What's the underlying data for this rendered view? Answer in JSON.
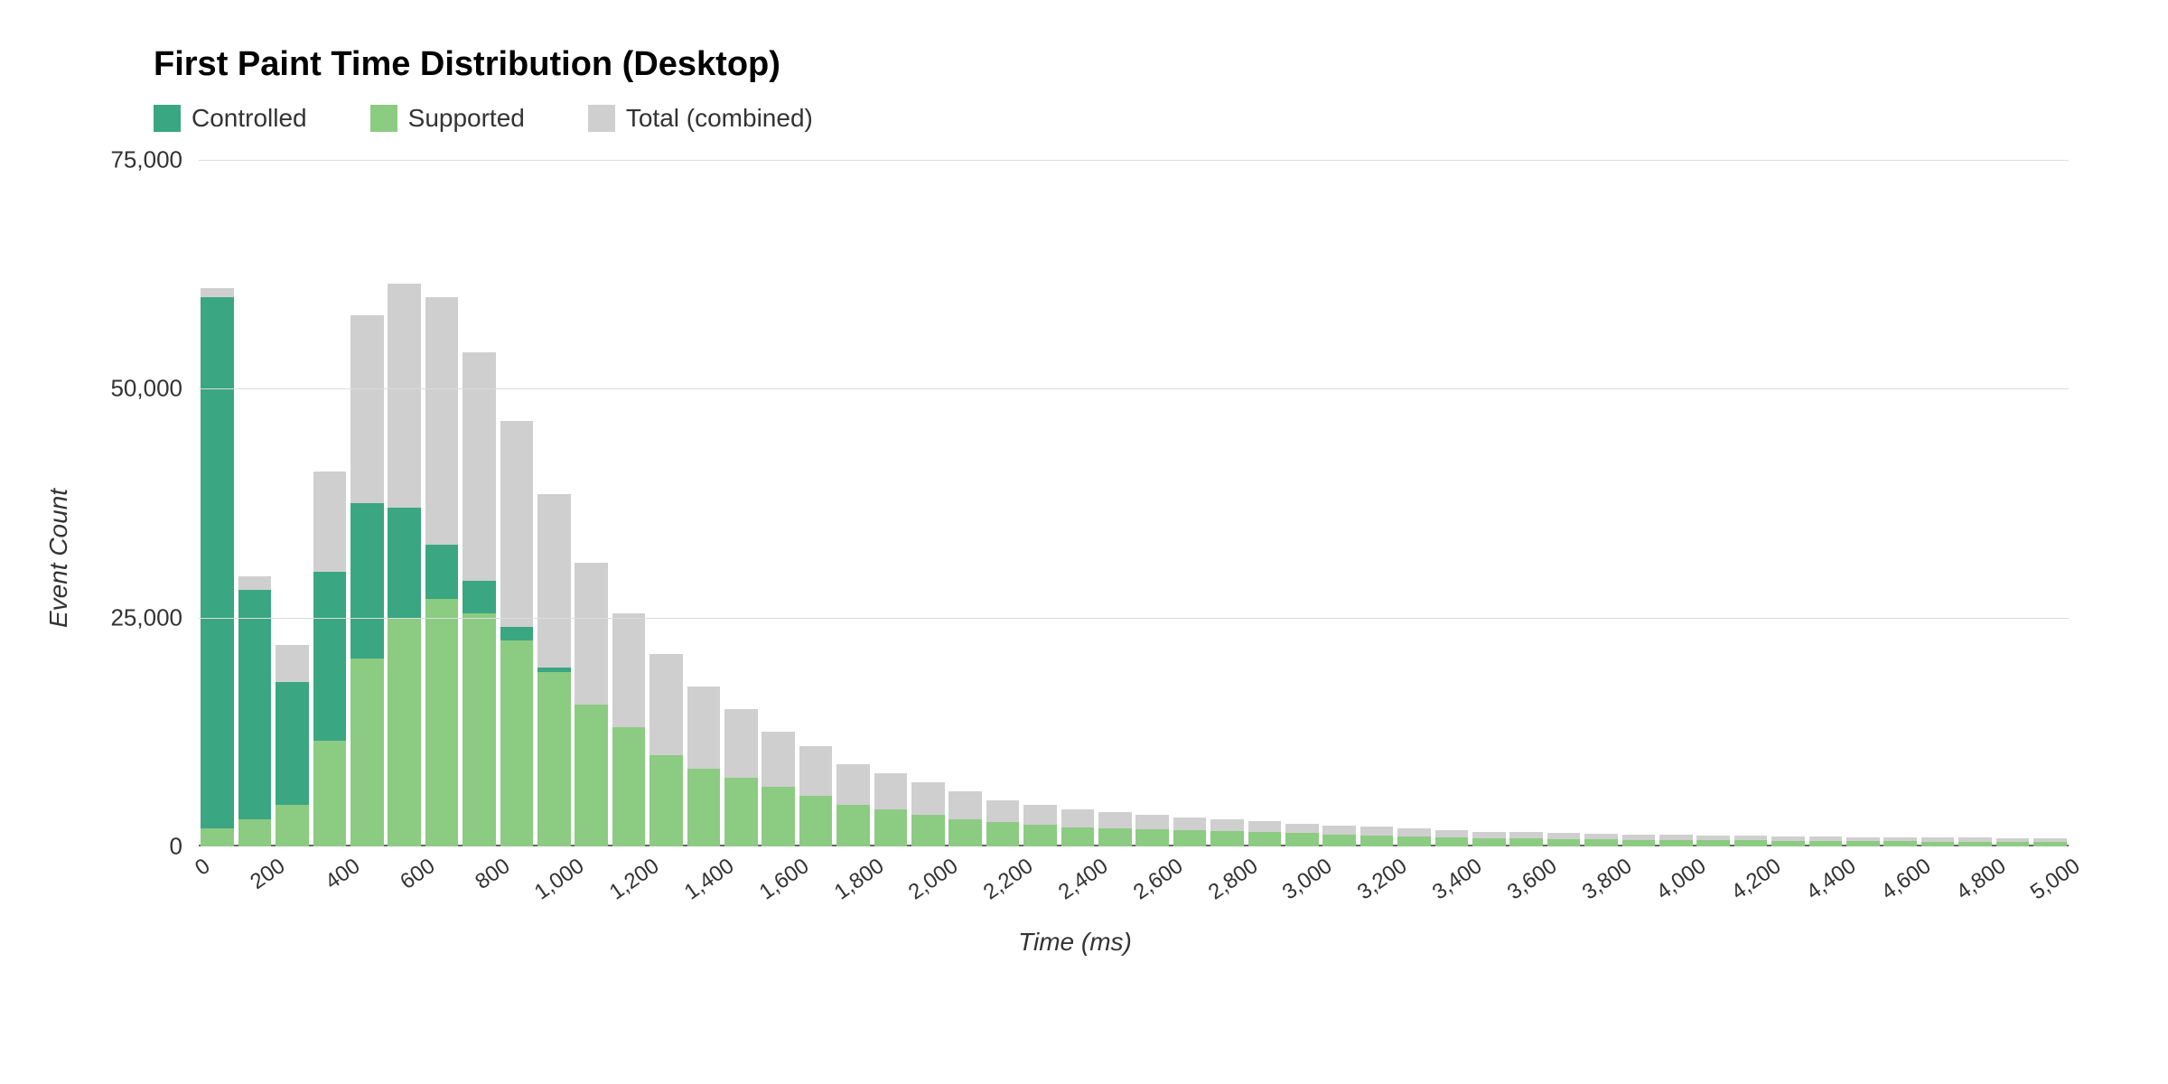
{
  "title": "First Paint Time Distribution (Desktop)",
  "xlabel": "Time (ms)",
  "ylabel": "Event Count",
  "legend": {
    "controlled": "Controlled",
    "supported": "Supported",
    "total": "Total (combined)"
  },
  "colors": {
    "controlled": "#3aa682",
    "supported": "#8ccb82",
    "total": "#cfcfcf"
  },
  "chart_data": {
    "type": "bar",
    "xlabel": "Time (ms)",
    "ylabel": "Event Count",
    "ylim": [
      0,
      75000
    ],
    "yticks": [
      0,
      25000,
      50000,
      75000
    ],
    "ytick_labels": [
      "0",
      "25,000",
      "50,000",
      "75,000"
    ],
    "categories": [
      0,
      100,
      200,
      300,
      400,
      500,
      600,
      700,
      800,
      900,
      1000,
      1100,
      1200,
      1300,
      1400,
      1500,
      1600,
      1700,
      1800,
      1900,
      2000,
      2100,
      2200,
      2300,
      2400,
      2500,
      2600,
      2700,
      2800,
      2900,
      3000,
      3100,
      3200,
      3300,
      3400,
      3500,
      3600,
      3700,
      3800,
      3900,
      4000,
      4100,
      4200,
      4300,
      4400,
      4500,
      4600,
      4700,
      4800,
      4900
    ],
    "xtick_positions": [
      0,
      200,
      400,
      600,
      800,
      1000,
      1200,
      1400,
      1600,
      1800,
      2000,
      2200,
      2400,
      2600,
      2800,
      3000,
      3200,
      3400,
      3600,
      3800,
      4000,
      4200,
      4400,
      4600,
      4800,
      5000
    ],
    "xtick_labels": [
      "0",
      "200",
      "400",
      "600",
      "800",
      "1,000",
      "1,200",
      "1,400",
      "1,600",
      "1,800",
      "2,000",
      "2,200",
      "2,400",
      "2,600",
      "2,800",
      "3,000",
      "3,200",
      "3,400",
      "3,600",
      "3,800",
      "4,000",
      "4,200",
      "4,400",
      "4,600",
      "4,800",
      "5,000"
    ],
    "series": [
      {
        "name": "Total (combined)",
        "color": "#cfcfcf",
        "values": [
          61000,
          29500,
          22000,
          41000,
          58000,
          61500,
          60000,
          54000,
          46500,
          38500,
          31000,
          25500,
          21000,
          17500,
          15000,
          12500,
          11000,
          9000,
          8000,
          7000,
          6000,
          5000,
          4500,
          4000,
          3800,
          3500,
          3200,
          3000,
          2800,
          2500,
          2300,
          2200,
          2000,
          1800,
          1600,
          1600,
          1500,
          1400,
          1300,
          1300,
          1200,
          1200,
          1100,
          1100,
          1000,
          1000,
          950,
          950,
          900,
          900
        ]
      },
      {
        "name": "Controlled",
        "color": "#3aa682",
        "values": [
          60000,
          28000,
          18000,
          30000,
          37500,
          37000,
          33000,
          29000,
          24000,
          19500,
          14000,
          11000,
          8000,
          7000,
          6000,
          5500,
          5000,
          4000,
          3500,
          3000,
          2500,
          2200,
          2000,
          1800,
          1700,
          1600,
          1500,
          1400,
          1300,
          1200,
          1100,
          1000,
          950,
          900,
          800,
          800,
          700,
          700,
          600,
          600,
          550,
          550,
          500,
          500,
          450,
          450,
          400,
          400,
          400,
          400
        ]
      },
      {
        "name": "Supported",
        "color": "#8ccb82",
        "values": [
          2000,
          3000,
          4500,
          11500,
          20500,
          25000,
          27000,
          25500,
          22500,
          19000,
          15500,
          13000,
          10000,
          8500,
          7500,
          6500,
          5500,
          4500,
          4000,
          3500,
          3000,
          2700,
          2400,
          2100,
          2000,
          1900,
          1800,
          1700,
          1600,
          1500,
          1300,
          1200,
          1100,
          1000,
          900,
          900,
          800,
          800,
          700,
          700,
          650,
          650,
          600,
          600,
          550,
          550,
          500,
          500,
          500,
          500
        ]
      }
    ]
  }
}
